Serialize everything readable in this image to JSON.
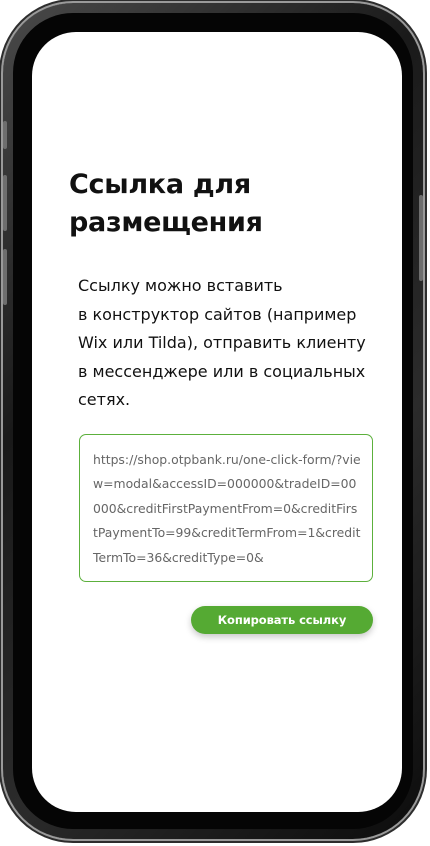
{
  "page": {
    "title": "Ссылка для размещения",
    "description": "Ссылку можно вставить\nв конструктор сайтов (например Wix или Tilda), отправить клиенту в мессенджере или в социальных сетях.",
    "link_url": "https://shop.otpbank.ru/one-click-form/?view=modal&accessID=000000&tradeID=00000&creditFirstPaymentFrom=0&creditFirstPaymentTo=99&creditTermFrom=1&creditTermTo=36&creditType=0&",
    "copy_button_label": "Копировать ссылку"
  },
  "colors": {
    "accent": "#55aa33",
    "border": "#5cb03c",
    "text": "#111111",
    "link_text": "#666666"
  }
}
